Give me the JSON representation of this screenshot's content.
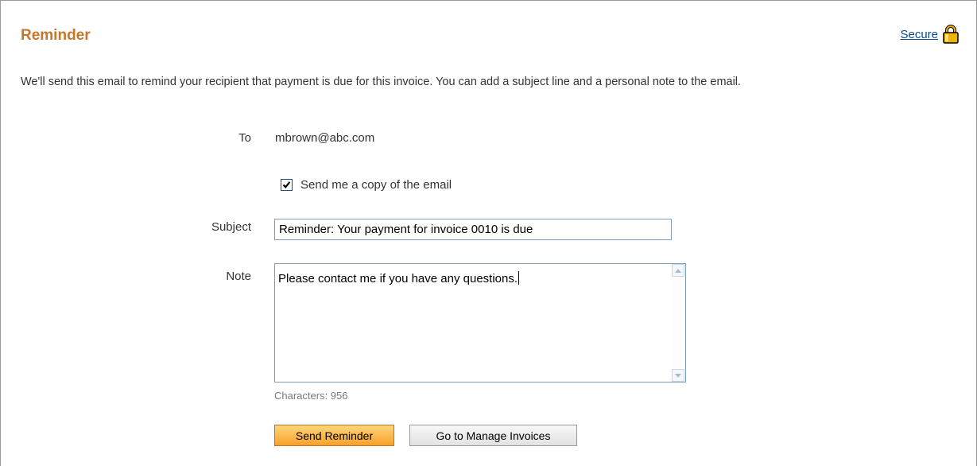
{
  "header": {
    "title": "Reminder",
    "secure_link": "Secure"
  },
  "intro": "We'll send this email to remind your recipient that payment is due for this invoice. You can add a subject line and a personal note to the email.",
  "form": {
    "to_label": "To",
    "to_value": "mbrown@abc.com",
    "copy_label": "Send me a copy of the email",
    "copy_checked": true,
    "subject_label": "Subject",
    "subject_value": "Reminder: Your payment for invoice 0010 is due",
    "note_label": "Note",
    "note_value": "Please contact me if you have any questions.",
    "char_count": "Characters: 956"
  },
  "actions": {
    "send_label": "Send Reminder",
    "manage_label": "Go to Manage Invoices"
  },
  "colors": {
    "title": "#c8762a",
    "link": "#084b8a",
    "primary_button": "#f8a12a",
    "lock": "#f2b300"
  },
  "icons": {
    "secure": "lock-icon",
    "checkbox": "checkmark-icon",
    "scroll_up": "arrow-up-icon",
    "scroll_down": "arrow-down-icon"
  }
}
